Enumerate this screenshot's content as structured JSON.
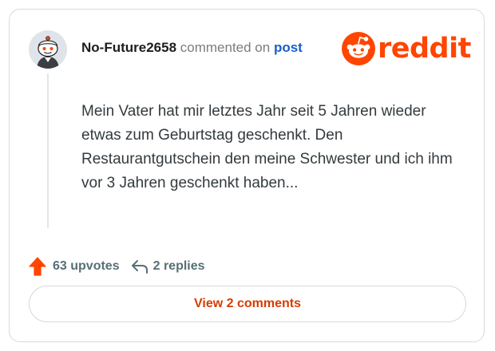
{
  "comment": {
    "username": "No-Future2658",
    "commented_on": "commented on",
    "post_link": "post",
    "body": "Mein Vater hat mir letztes Jahr seit 5 Jahren wieder etwas zum Geburtstag geschenkt. Den Restaurantgutschein den meine Schwester und ich ihm vor 3 Jahren geschenkt haben...",
    "upvotes": "63 upvotes",
    "replies": "2 replies"
  },
  "brand": {
    "name": "reddit",
    "color": "#ff4500"
  },
  "footer": {
    "view_comments": "View 2 comments"
  },
  "icons": {
    "avatar": "snoo-avatar",
    "logo": "reddit-snoo-icon",
    "upvote": "upvote-arrow-icon",
    "reply": "reply-arrow-icon"
  },
  "colors": {
    "upvote": "#ff4500",
    "link": "#1a5fc9",
    "button_text": "#d93a00",
    "meta_text": "#576f76"
  }
}
